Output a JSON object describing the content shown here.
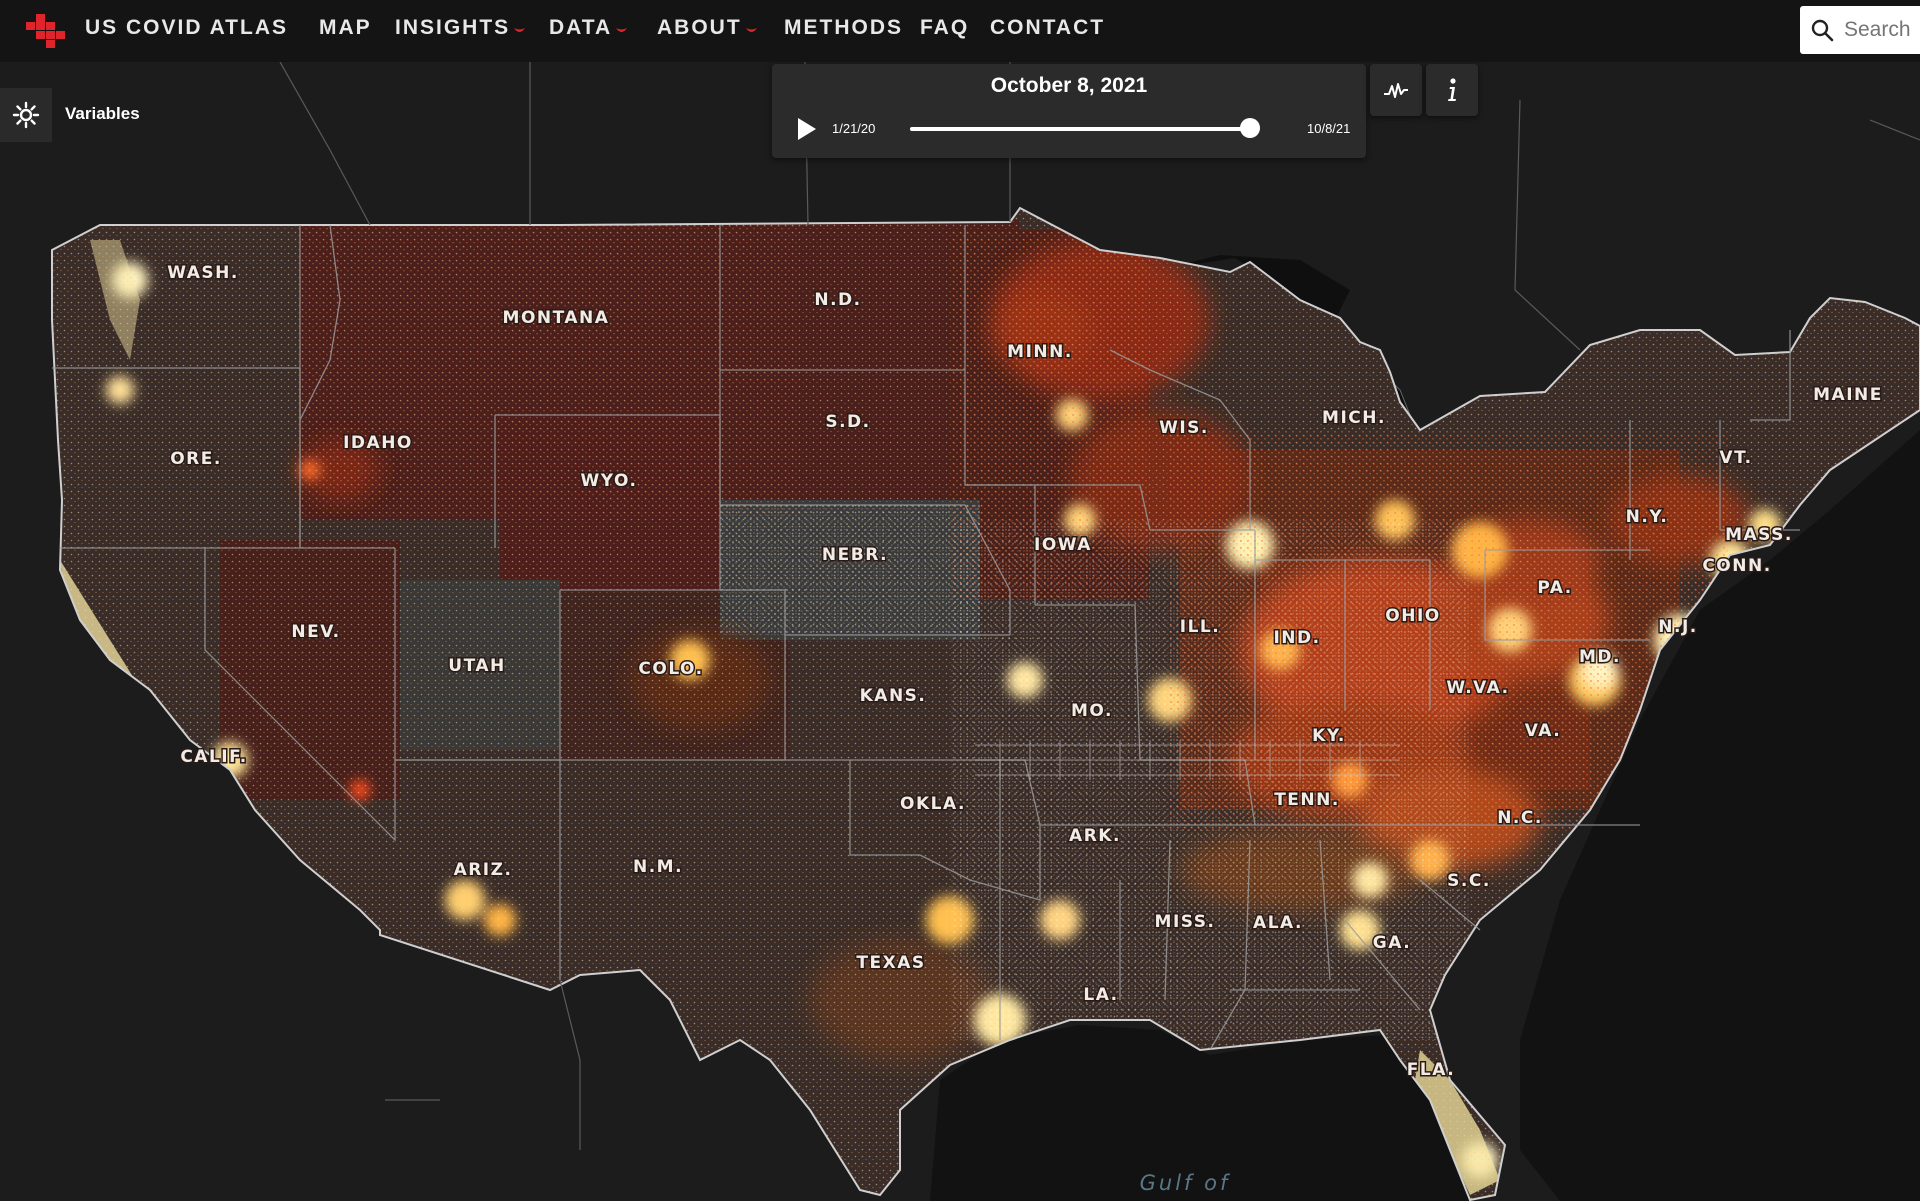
{
  "app": {
    "title": "US COVID ATLAS"
  },
  "nav": {
    "items": [
      {
        "label": "MAP",
        "has_menu": false
      },
      {
        "label": "INSIGHTS",
        "has_menu": true
      },
      {
        "label": "DATA",
        "has_menu": true
      },
      {
        "label": "ABOUT",
        "has_menu": true
      },
      {
        "label": "METHODS",
        "has_menu": false
      },
      {
        "label": "FAQ",
        "has_menu": false
      },
      {
        "label": "CONTACT",
        "has_menu": false
      }
    ],
    "search_placeholder": "Search"
  },
  "panel": {
    "variables_label": "Variables"
  },
  "timeline": {
    "current_date": "October 8, 2021",
    "start_date": "1/21/20",
    "end_date": "10/8/21",
    "progress": 0.97
  },
  "tools": [
    "line-chart-icon",
    "info-icon"
  ],
  "map": {
    "state_labels": [
      "WASH.",
      "MONTANA",
      "N.D.",
      "MINN.",
      "MAINE",
      "ORE.",
      "IDAHO",
      "S.D.",
      "WIS.",
      "MICH.",
      "VT.",
      "WYO.",
      "N.Y.",
      "MASS.",
      "IOWA",
      "NEBR.",
      "CONN.",
      "PA.",
      "NEV.",
      "OHIO",
      "ILL.",
      "IND.",
      "N.J.",
      "UTAH",
      "COLO.",
      "MD.",
      "W.VA.",
      "KANS.",
      "MO.",
      "KY.",
      "VA.",
      "CALIF.",
      "TENN.",
      "OKLA.",
      "N.C.",
      "ARK.",
      "ARIZ.",
      "N.M.",
      "S.C.",
      "MISS.",
      "ALA.",
      "GA.",
      "TEXAS",
      "LA.",
      "FLA."
    ],
    "water_label": "Gulf of"
  },
  "colors": {
    "nav_bg": "#141414",
    "accent_red": "#e0242c",
    "map_bg": "#1a1a1a",
    "hot_dark": "#4a1c18",
    "hot_mid": "#c2401c",
    "hot_light": "#f6a23a",
    "hot_pale": "#fff3b0"
  }
}
